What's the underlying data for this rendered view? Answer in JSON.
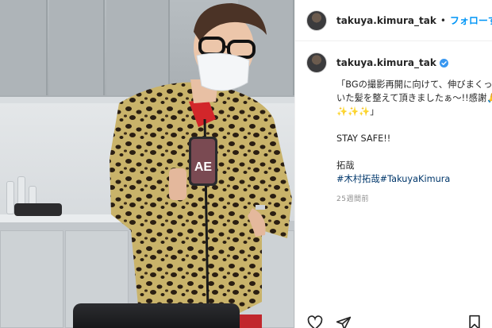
{
  "post": {
    "username": "takuya.kimura_tak",
    "separator": "•",
    "follow_label": "フォローする",
    "caption_username": "takuya.kimura_tak",
    "caption_lines": [
      "「BGの撮影再開に向けて、伸びまくっ",
      "いた髪を整えて頂きましたぁ〜!!感謝🙏",
      "✨✨✨」"
    ],
    "stay_safe": "STAY SAFE!!",
    "signature": "拓哉",
    "hashtags": "#木村拓哉#TakuyaKimura",
    "time": "25週間前"
  },
  "photo": {
    "phone_label": "AE"
  },
  "colors": {
    "accent": "#0095f6",
    "hashtag": "#00376b",
    "verified": "#3897f0",
    "muted": "#8e8e8e"
  },
  "icons": {
    "like": "heart-icon",
    "share": "send-icon",
    "save": "bookmark-icon",
    "verified": "verified-badge-icon"
  }
}
